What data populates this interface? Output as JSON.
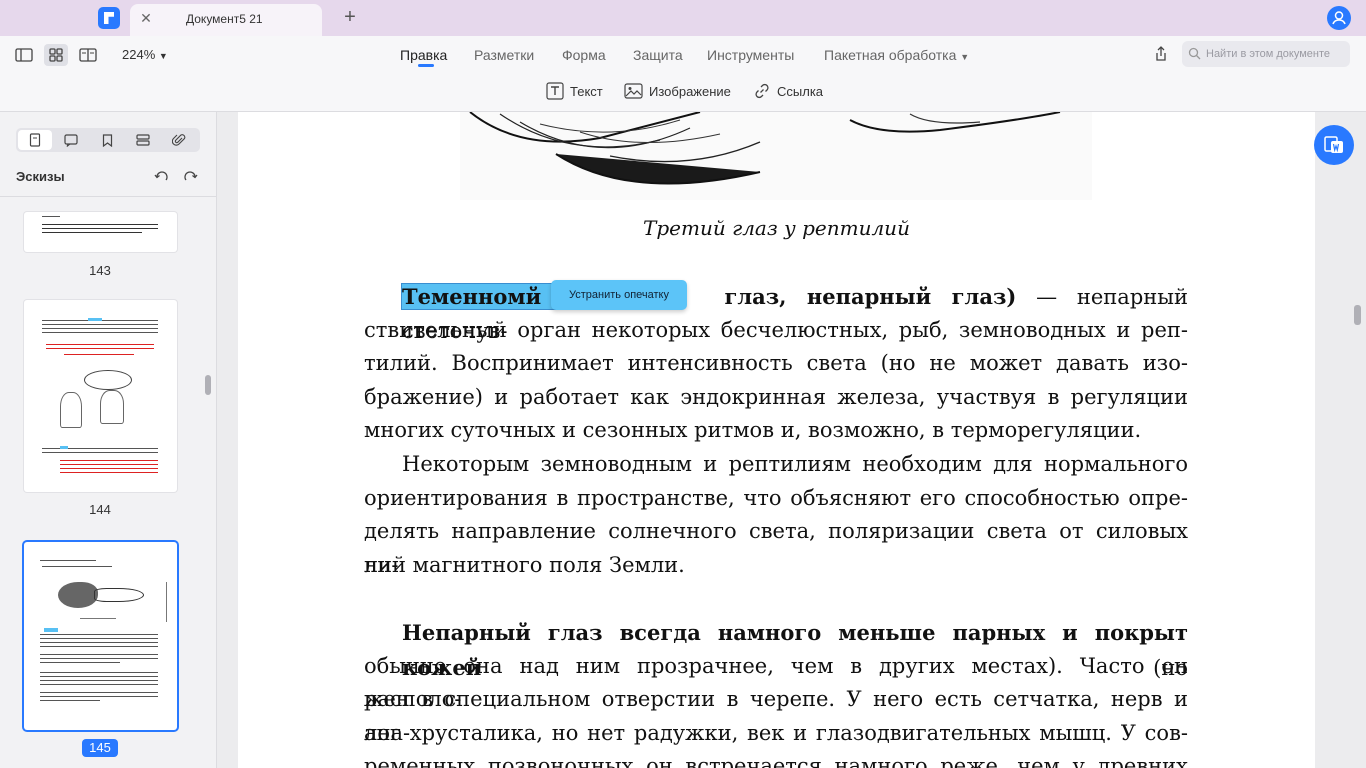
{
  "tab": {
    "title": "Документ5 21",
    "close": "✕",
    "new": "+"
  },
  "toolbar": {
    "zoom": "224%",
    "menu": [
      "Правка",
      "Разметки",
      "Форма",
      "Защита",
      "Инструменты",
      "Пакетная обработка"
    ],
    "search_placeholder": "Найти в этом документе",
    "sub": [
      "Текст",
      "Изображение",
      "Ссылка"
    ]
  },
  "sidebar": {
    "title": "Эскизы",
    "pages": [
      "143",
      "144",
      "145"
    ]
  },
  "document": {
    "caption": "Третий глаз у рептилий",
    "p1_highlight": "Теменномй г",
    "p1_bold_rest": "глаз, непарный глаз)",
    "p1_line1_rest": " — непарный светочув-",
    "p1_lines": [
      "ствительный орган некоторых бесчелюстных, рыб, земноводных и реп-",
      "тилий. Воспринимает интенсивность света (но не может давать изо-",
      "бражение) и работает как эндокринная железа, участвуя в регуляции",
      "многих суточных и сезонных ритмов и, возможно, в терморегуляции."
    ],
    "p2_lines": [
      "Некоторым земноводным и рептилиям необходим для нормального",
      "ориентирования в пространстве, что объясняют его способностью опре-",
      "делять направление солнечного света, поляризации света от силовых ли-",
      "ний магнитного поля Земли."
    ],
    "p3_bold": "Непарный глаз всегда намного меньше парных и покрыт кожей",
    "p3_line1_rest": " (но",
    "p3_lines": [
      "обычно она над ним прозрачнее, чем в других местах). Часто он располо-",
      "жен в специальном отверстии в черепе. У него есть сетчатка, нерв и ана-",
      "лог хрусталика, но нет радужки, век и глазодвигательных мышц. У сов-",
      "ременных позвоночных он встречается намного реже, чем у древних"
    ]
  },
  "tooltip": "Устранить опечатку",
  "colors": {
    "accent": "#2979ff",
    "highlight": "#58c0f3",
    "titlebar": "#e6d8ec"
  }
}
